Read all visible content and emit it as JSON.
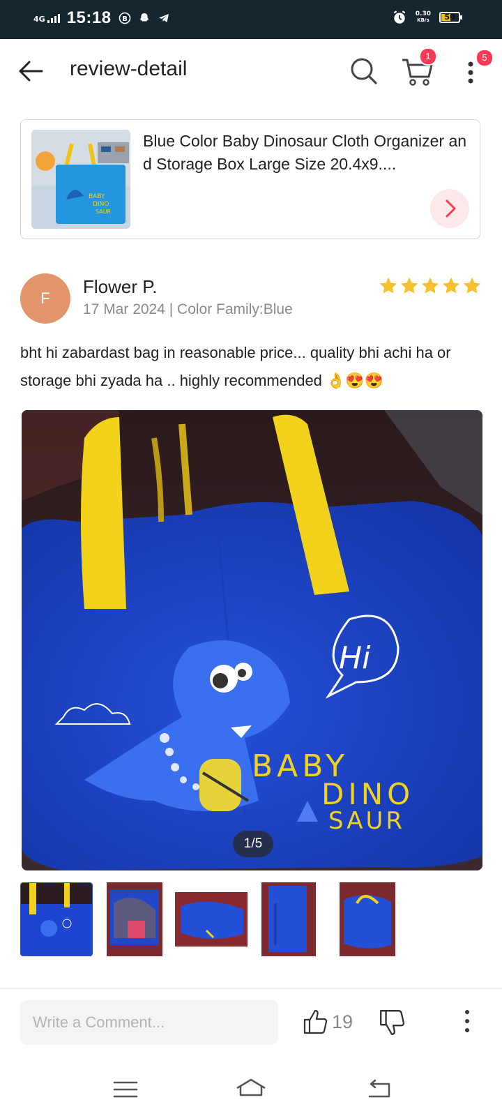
{
  "status_bar": {
    "network": "4G",
    "time": "15:18",
    "speed_value": "0.30",
    "speed_unit": "KB/s",
    "battery_percent": "50",
    "battery_level": 0.5
  },
  "header": {
    "title": "review-detail",
    "cart_badge": "1",
    "more_badge": "5"
  },
  "product": {
    "title": "Blue Color Baby Dinosaur Cloth Organizer and Storage Box Large Size 20.4x9....",
    "thumb_text_1": "BABY",
    "thumb_text_2": "DINO",
    "thumb_text_3": "SAUR"
  },
  "review": {
    "avatar_letter": "F",
    "reviewer": "Flower P.",
    "meta": "17 Mar 2024 | Color Family:Blue",
    "rating": 5,
    "text": "bht hi zabardast bag in reasonable price... quality bhi achi ha or storage bhi zyada ha .. highly recommended 👌😍😍"
  },
  "photo": {
    "speech": "Hi",
    "bag_text_1": "BABY",
    "bag_text_2": "DINO",
    "bag_text_3": "SAUR",
    "counter": "1/5"
  },
  "footer": {
    "comment_placeholder": "Write a Comment...",
    "like_count": "19"
  },
  "colors": {
    "accent": "#fa3a55",
    "star": "#f6c12b",
    "bag_blue": "#1d3fc4",
    "handle_yellow": "#f2d21a"
  }
}
